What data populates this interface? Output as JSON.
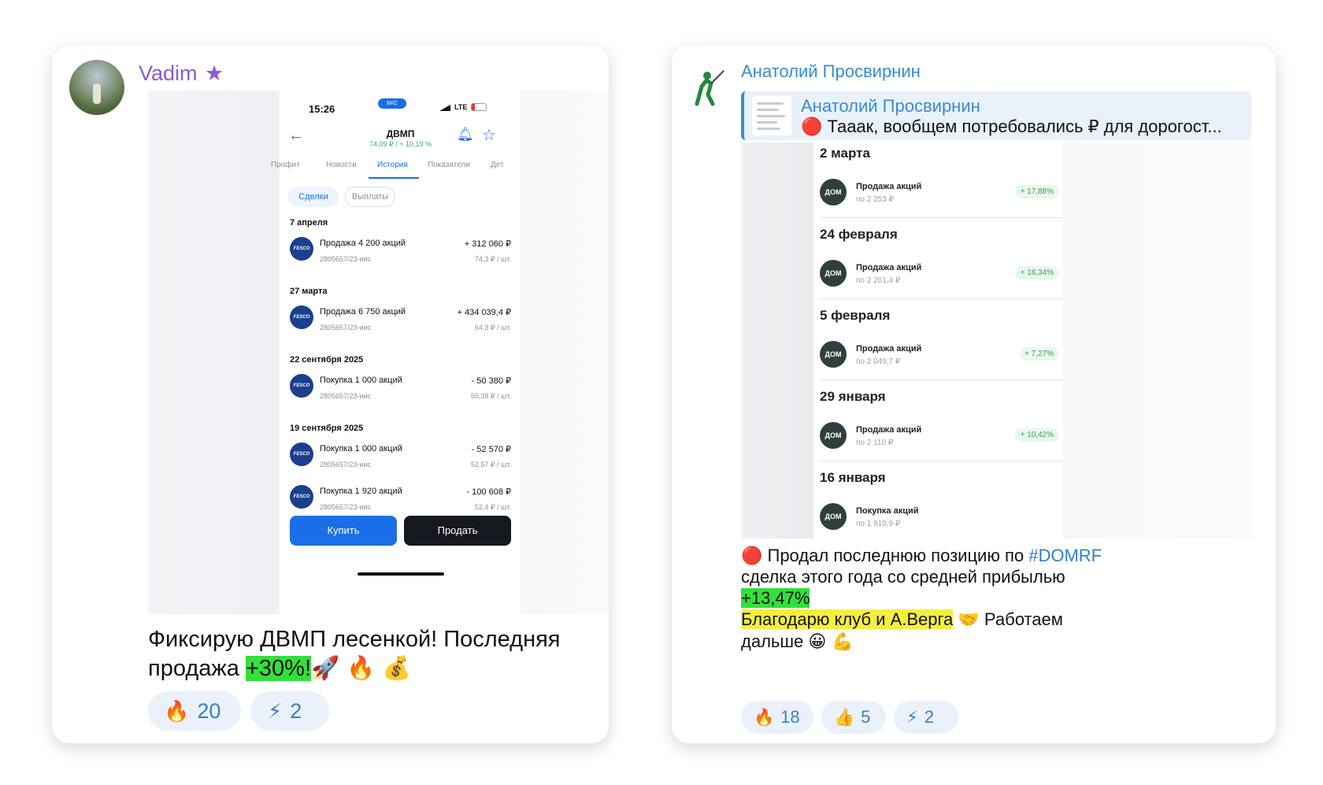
{
  "left_post": {
    "author": "Vadim",
    "author_star": "★",
    "phone": {
      "time": "15:26",
      "carrier_badge": "БКС",
      "status_right": "LTE",
      "ticker": "ДВМП",
      "price_line": "74,09 ₽ / + 10,19 %",
      "tabs": [
        "Профит",
        "Новости",
        "История",
        "Показатели",
        "Дет"
      ],
      "active_tab": "История",
      "chips": [
        "Сделки",
        "Выплаты"
      ],
      "logo_text": "FESCO",
      "groups": [
        {
          "date": "7 апреля",
          "title": "Продажа 4 200 акций",
          "order": "2805657/23-иис",
          "amount": "+ 312 060 ₽",
          "per": "74,3 ₽ / шт."
        },
        {
          "date": "27 марта",
          "title": "Продажа 6 750 акций",
          "order": "2805657/23-иис",
          "amount": "+ 434 039,4 ₽",
          "per": "64,3 ₽ / шт."
        },
        {
          "date": "22 сентября 2025",
          "title": "Покупка 1 000 акций",
          "order": "2805657/23-иис",
          "amount": "- 50 380 ₽",
          "per": "50,38 ₽ / шт."
        },
        {
          "date": "19 сентября 2025",
          "title": "Покупка 1 000 акций",
          "order": "2805657/23-иис",
          "amount": "- 52 570 ₽",
          "per": "52,57 ₽ / шт."
        },
        {
          "date": "",
          "title": "Покупка 1 920 акций",
          "order": "2805657/23-иис",
          "amount": "- 100 608 ₽",
          "per": "52,4 ₽ / шт."
        }
      ],
      "buy_label": "Купить",
      "sell_label": "Продать"
    },
    "caption_start": "Фиксирую ДВМП лесенкой! Последняя продажа ",
    "caption_highlight": "+30%!",
    "caption_emojis": "🚀 🔥 💰",
    "reactions": [
      {
        "emoji": "🔥",
        "count": "20"
      },
      {
        "emoji": "⚡",
        "count": "2"
      }
    ]
  },
  "right_post": {
    "author": "Анатолий Просвирнин",
    "reply": {
      "author": "Анатолий Просвирнин",
      "text": "🔴 Тааак, вообщем потребовались ₽ для дорогост..."
    },
    "screenshot": {
      "logo_text": "ДОМ РФ",
      "items": [
        {
          "date": "2 марта",
          "title": "Продажа акций",
          "sub": "по 2 253 ₽",
          "pct": "+ 17,88%"
        },
        {
          "date": "24 февраля",
          "title": "Продажа акций",
          "sub": "по 2 261,4 ₽",
          "pct": "+ 18,34%"
        },
        {
          "date": "5 февраля",
          "title": "Продажа акций",
          "sub": "по 2 049,7 ₽",
          "pct": "+ 7,27%"
        },
        {
          "date": "29 января",
          "title": "Продажа акций",
          "sub": "по 2 110 ₽",
          "pct": "+ 10,42%"
        },
        {
          "date": "16 января",
          "title": "Покупка акций",
          "sub": "по 1 910,9 ₽",
          "pct": ""
        }
      ]
    },
    "text": {
      "line1_prefix": "🔴 Продал последнюю позицию по ",
      "hashtag": "#DOMRF",
      "line2": "сделка этого года со средней прибылью",
      "profit": "+13,47%",
      "thanks": "Благодарю клуб и А.Верга",
      "thanks_emoji": "🤝",
      "line4_rest": " Работаем",
      "line5": "дальше",
      "line5_emojis": "😀 💪"
    },
    "reactions": [
      {
        "emoji": "🔥",
        "count": "18"
      },
      {
        "emoji": "👍",
        "count": "5"
      },
      {
        "emoji": "⚡",
        "count": "2"
      }
    ]
  },
  "colors": {
    "author_left": "#8c5bd6",
    "author_right": "#3a8bd6",
    "accent_blue": "#1a6ee8",
    "highlight_green": "#33e03a",
    "highlight_yellow": "#f5ee3c"
  }
}
